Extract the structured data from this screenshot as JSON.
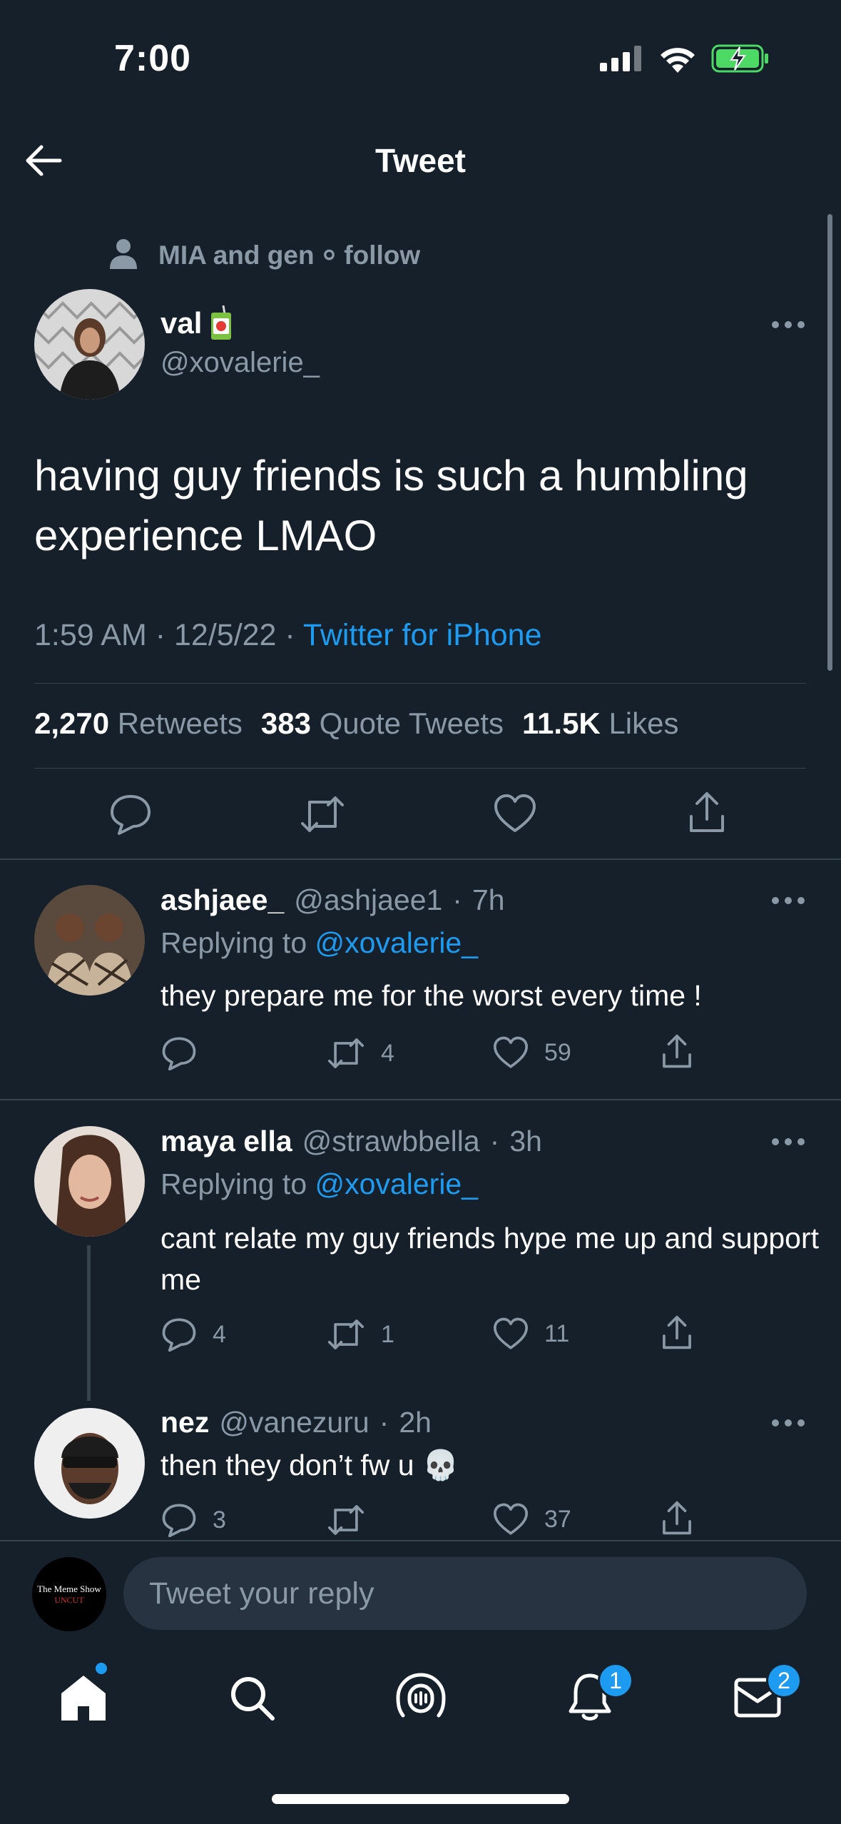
{
  "status_bar": {
    "time": "7:00"
  },
  "header": {
    "title": "Tweet"
  },
  "main_tweet": {
    "social_context": "MIA and gen ⸰ follow",
    "author_name": "val",
    "author_handle": "@xovalerie_",
    "text": "having guy friends is such a humbling experience LMAO",
    "time": "1:59 AM",
    "date": "12/5/22",
    "source": "Twitter for iPhone",
    "stats": {
      "retweets": "2,270",
      "retweets_label": "Retweets",
      "quotes": "383",
      "quotes_label": "Quote Tweets",
      "likes": "11.5K",
      "likes_label": "Likes"
    }
  },
  "replies": [
    {
      "name": "ashjaee_",
      "handle": "@ashjaee1",
      "time": "7h",
      "replying_prefix": "Replying to",
      "replying_to": "@xovalerie_",
      "text": "they prepare me for the worst every time !",
      "replies": "",
      "retweets": "4",
      "likes": "59"
    },
    {
      "name": "maya ella",
      "handle": "@strawbbella",
      "time": "3h",
      "replying_prefix": "Replying to",
      "replying_to": "@xovalerie_",
      "text": "cant relate my guy friends hype me up and support me",
      "replies": "4",
      "retweets": "1",
      "likes": "11"
    },
    {
      "name": "nez",
      "handle": "@vanezuru",
      "time": "2h",
      "text": "then they don’t fw u 💀",
      "replies": "3",
      "retweets": "",
      "likes": "37"
    }
  ],
  "reply_composer": {
    "placeholder": "Tweet your reply",
    "avatar_line1": "The Meme Show",
    "avatar_line2": "UNCUT"
  },
  "tab_bar": {
    "notifications_badge": "1",
    "messages_badge": "2"
  },
  "colors": {
    "background": "#15202b",
    "accent": "#1d9bf0",
    "muted": "#8b98a5",
    "battery": "#4cd964"
  }
}
